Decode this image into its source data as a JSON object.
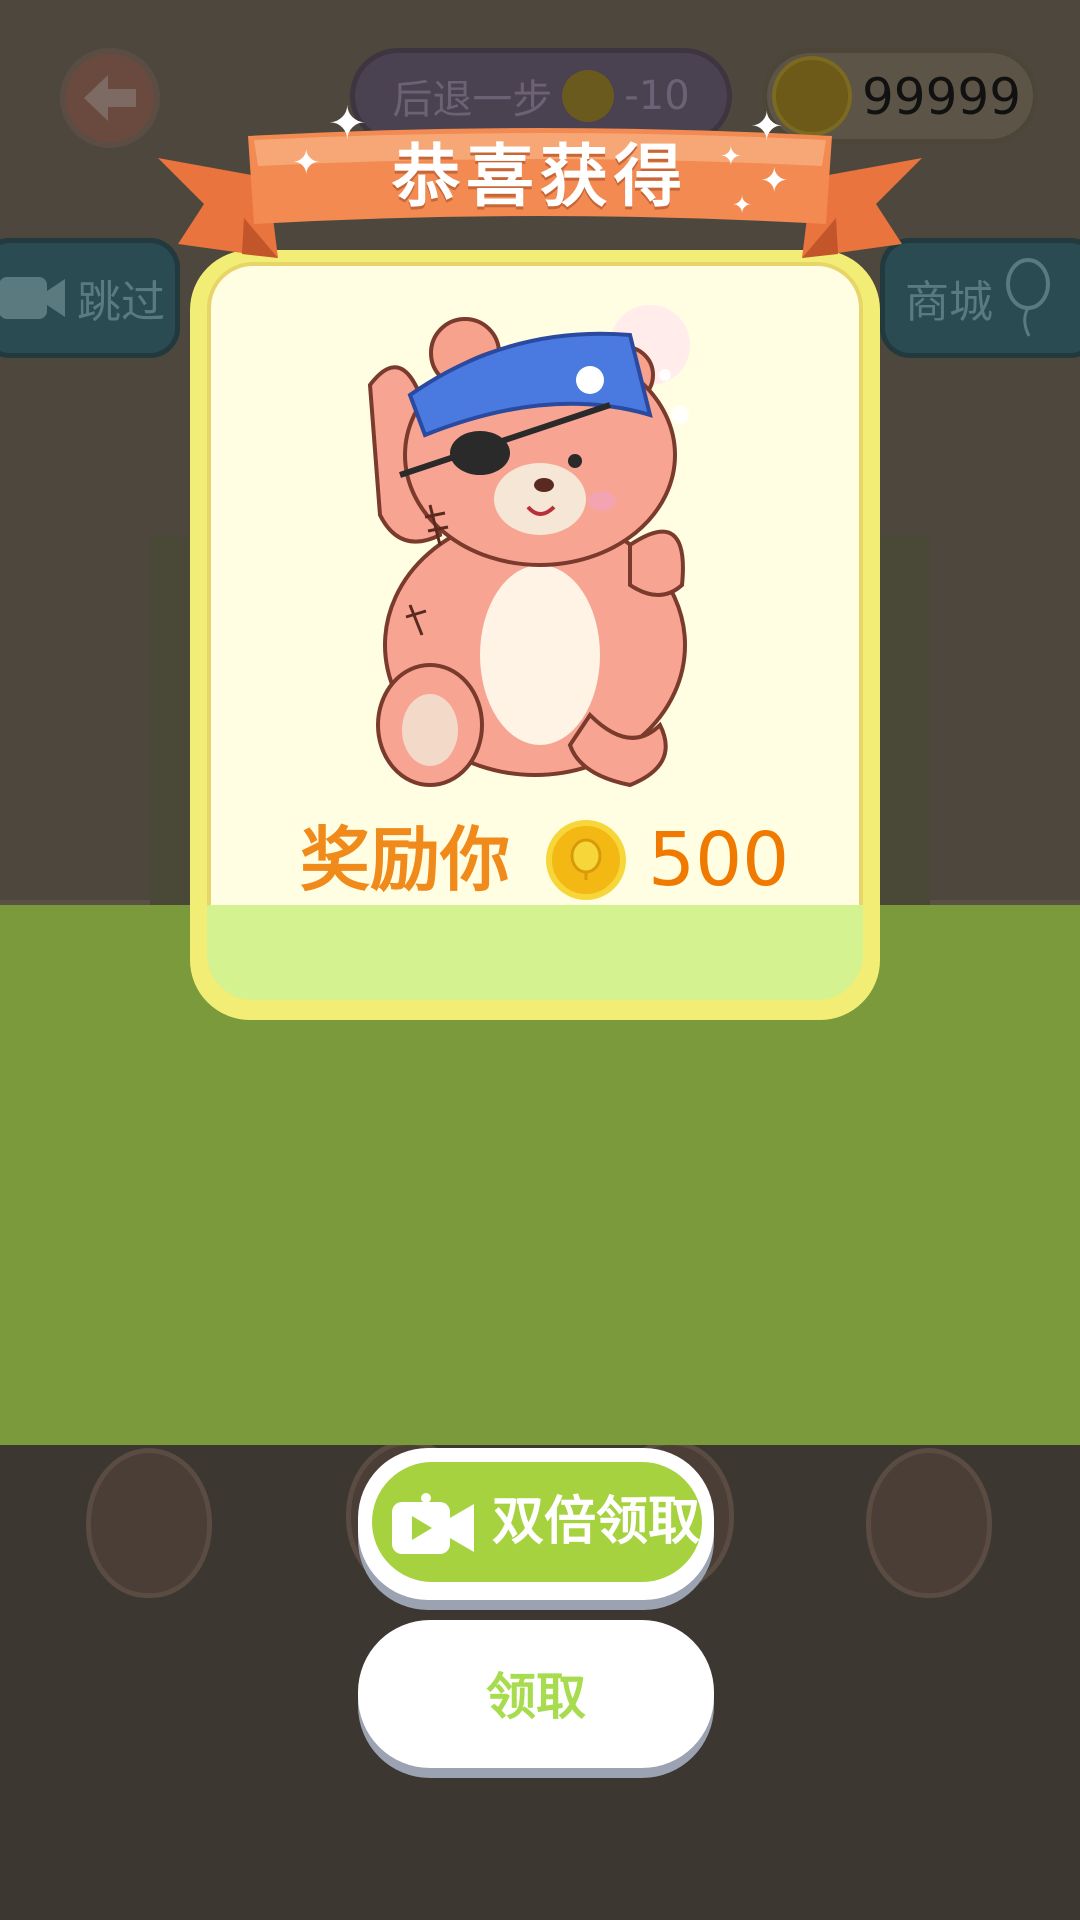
{
  "hud": {
    "undo_label": "后退一步",
    "undo_cost": "-10",
    "coin_balance": "99999",
    "skip_label": "跳过",
    "shop_label": "商城"
  },
  "modal": {
    "title": "恭喜获得",
    "reward_label": "奖励你",
    "reward_amount": "500",
    "prize_name": "pirate-teddy-bear"
  },
  "buttons": {
    "double_claim": "双倍领取",
    "claim": "领取"
  },
  "icons": {
    "back": "back-arrow-icon",
    "coin": "balloon-coin-icon",
    "video": "video-camera-icon"
  },
  "colors": {
    "ribbon": "#f28a52",
    "card_border": "#f2ee75",
    "card_fill": "#fffde2",
    "reward_text": "#f08a1a",
    "double_button": "#a7d240",
    "claim_text": "#a6dc4d"
  }
}
